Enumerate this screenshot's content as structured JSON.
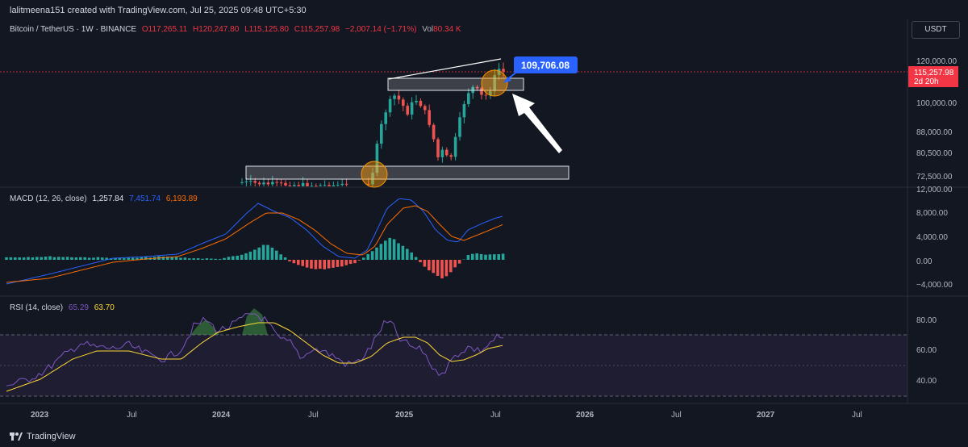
{
  "header": {
    "credit": "lalitmeena151 created with TradingView.com, Jul 25, 2025 09:48 UTC+5:30"
  },
  "symbol": {
    "name": "Bitcoin / TetherUS · 1W · BINANCE",
    "open": "O117,265.11",
    "high": "H120,247.80",
    "low": "L115,125.80",
    "close": "C115,257.98",
    "change": "−2,007.14 (−1.71%)",
    "vol_label": "Vol",
    "vol_value": "80.34 K"
  },
  "currency_button": "USDT",
  "price_axis": {
    "labels": [
      "120,000.00",
      "100,000.00",
      "88,000.00",
      "80,500.00",
      "72,500.00"
    ],
    "current_price": "115,257.98",
    "countdown": "2d 20h"
  },
  "callout": {
    "value": "109,706.08"
  },
  "macd": {
    "title": "MACD (12, 26, close)",
    "hist": "1,257.84",
    "macd": "7,451.74",
    "signal": "6,193.89",
    "axis_labels": [
      "12,000.00",
      "8,000.00",
      "4,000.00",
      "0.00",
      "−4,000.00"
    ]
  },
  "rsi": {
    "title": "RSI (14, close)",
    "rsi": "65.29",
    "ma": "63.70",
    "axis_labels": [
      "80.00",
      "60.00",
      "40.00"
    ]
  },
  "time_axis": [
    "2023",
    "Jul",
    "2024",
    "Jul",
    "2025",
    "Jul",
    "2026",
    "Jul",
    "2027",
    "Jul"
  ],
  "footer": {
    "brand": "TradingView"
  },
  "colors": {
    "background": "#131722",
    "up": "#26a69a",
    "down": "#ef5350",
    "macd_line": "#2962ff",
    "signal_line": "#ff6d00",
    "rsi_line": "#7e57c2",
    "rsi_ma": "#fdd835",
    "callout": "#2962ff",
    "current_price": "#f23645"
  },
  "chart_data": [
    {
      "type": "candlestick",
      "title": "Bitcoin / TetherUS · 1W · BINANCE",
      "timeframe": "1W",
      "ohlc_last": {
        "open": 117265.11,
        "high": 120247.8,
        "low": 115125.8,
        "close": 115257.98
      },
      "ylim": [
        68000,
        126000
      ],
      "annotations": [
        {
          "type": "callout",
          "value": 109706.08
        },
        {
          "type": "support_zone",
          "from": 72500,
          "to": 75500
        },
        {
          "type": "resistance_zone",
          "from": 105000,
          "to": 109500
        }
      ]
    },
    {
      "type": "line",
      "title": "MACD (12, 26, close)",
      "last": {
        "histogram": 1257.84,
        "macd": 7451.74,
        "signal": 6193.89
      },
      "ylim": [
        -6000,
        12000
      ]
    },
    {
      "type": "line",
      "title": "RSI (14, close)",
      "last": {
        "rsi": 65.29,
        "ma": 63.7
      },
      "ylim": [
        30,
        90
      ]
    }
  ]
}
